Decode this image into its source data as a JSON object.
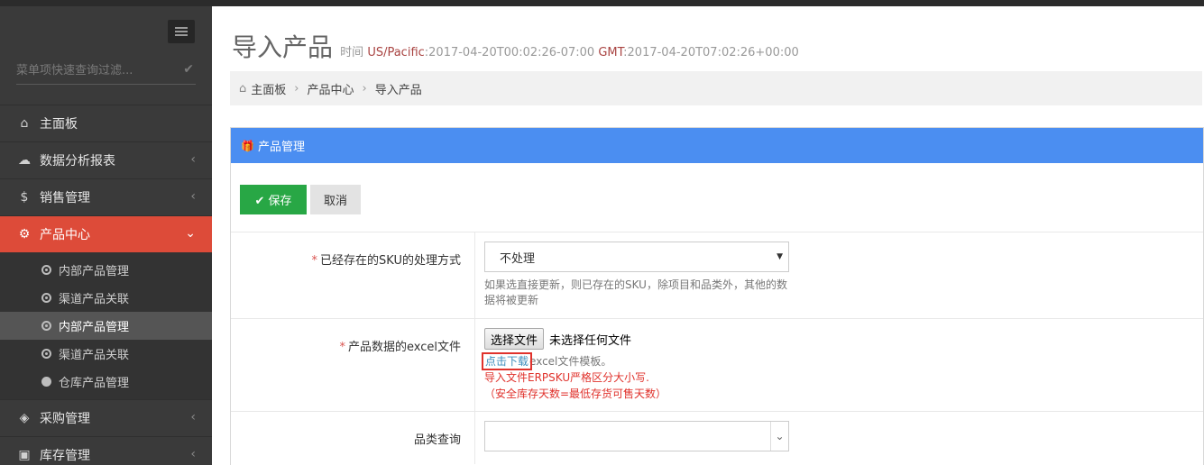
{
  "sidebar": {
    "filter_placeholder": "菜单项快速查询过滤...",
    "menu": [
      {
        "label": "主面板",
        "icon": "home-icon",
        "has_arrow": false
      },
      {
        "label": "数据分析报表",
        "icon": "cloud-icon",
        "has_arrow": true
      },
      {
        "label": "销售管理",
        "icon": "dollar-icon",
        "has_arrow": true
      },
      {
        "label": "产品中心",
        "icon": "cogs-icon",
        "has_arrow": true,
        "active": true
      },
      {
        "label": "采购管理",
        "icon": "cube-icon",
        "has_arrow": true
      },
      {
        "label": "库存管理",
        "icon": "android-icon",
        "has_arrow": true
      }
    ],
    "submenu": [
      {
        "label": "内部产品管理"
      },
      {
        "label": "渠道产品关联"
      },
      {
        "label": "内部产品管理",
        "selected": true
      },
      {
        "label": "渠道产品关联"
      },
      {
        "label": "仓库产品管理",
        "filled": true
      }
    ]
  },
  "header": {
    "title": "导入产品",
    "time_prefix": "时间",
    "tz1": "US/Pacific",
    "time1": ":2017-04-20T00:02:26-07:00",
    "tz2": "GMT",
    "time2": ":2017-04-20T07:02:26+00:00"
  },
  "breadcrumb": [
    "主面板",
    "产品中心",
    "导入产品"
  ],
  "panel": {
    "title": "产品管理",
    "save_label": "保存",
    "cancel_label": "取消"
  },
  "form": {
    "sku_label": "已经存在的SKU的处理方式",
    "sku_value": "不处理",
    "sku_help": "如果选直接更新，则已存在的SKU，除项目和品类外，其他的数据将被更新",
    "excel_label": "产品数据的excel文件",
    "file_button": "选择文件",
    "file_none": "未选择任何文件",
    "download_link": "点击下载",
    "download_suffix": "excel文件模板。",
    "warn1": "导入文件ERPSKU严格区分大小写.",
    "warn2": "（安全库存天数=最低存货可售天数）",
    "category_label": "品类查询",
    "category_value": ""
  },
  "colors": {
    "sidebar_bg": "#3a3a3a",
    "active_red": "#dd4b39",
    "panel_blue": "#4b8ef1",
    "save_green": "#28a745",
    "warn_red": "#e0322c"
  }
}
